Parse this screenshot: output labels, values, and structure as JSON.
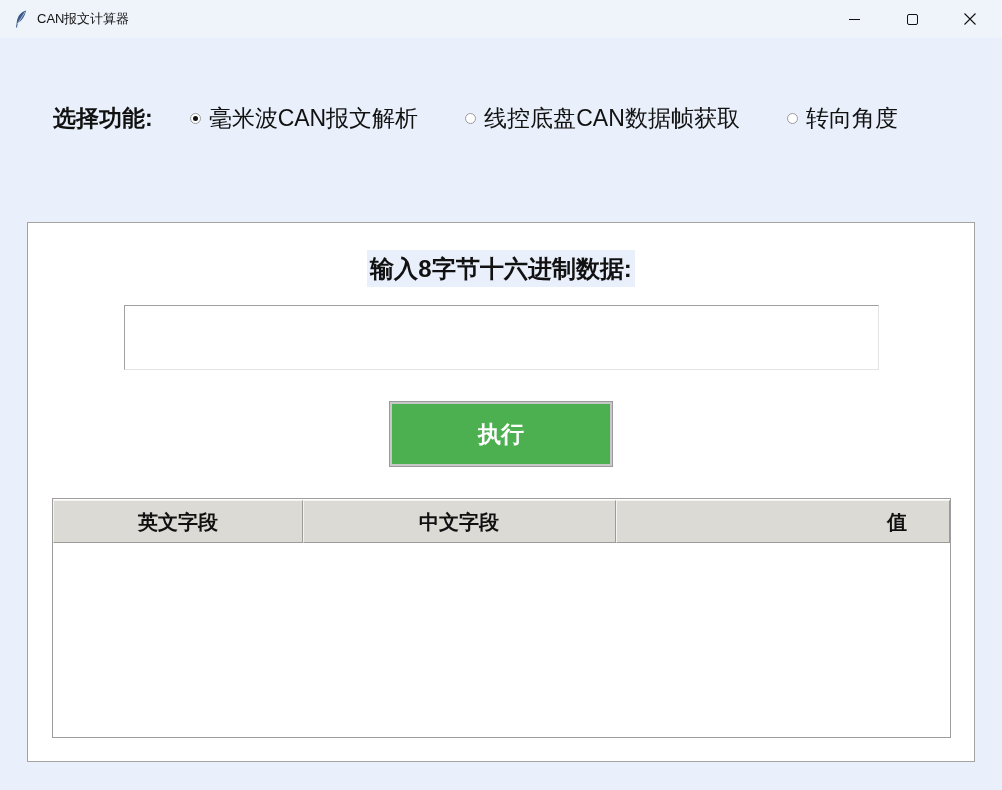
{
  "window": {
    "title": "CAN报文计算器"
  },
  "function_select": {
    "label": "选择功能:",
    "options": [
      {
        "label": "毫米波CAN报文解析",
        "selected": true
      },
      {
        "label": "线控底盘CAN数据帧获取",
        "selected": false
      },
      {
        "label": "转向角度",
        "selected": false
      }
    ]
  },
  "input": {
    "label": "输入8字节十六进制数据:"
  },
  "execute_button": {
    "label": "执行"
  },
  "table": {
    "columns": [
      "英文字段",
      "中文字段",
      "值"
    ]
  }
}
